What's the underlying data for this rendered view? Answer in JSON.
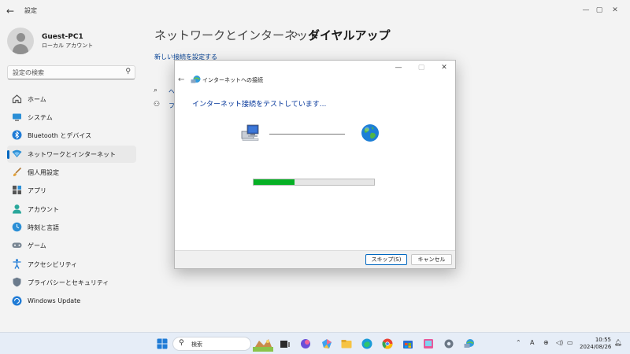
{
  "app": {
    "title": "設定"
  },
  "user": {
    "name": "Guest-PC1",
    "account_type": "ローカル アカウント"
  },
  "search": {
    "placeholder": "設定の検索"
  },
  "nav": [
    {
      "label": "ホーム",
      "icon": "home-icon"
    },
    {
      "label": "システム",
      "icon": "system-icon"
    },
    {
      "label": "Bluetooth とデバイス",
      "icon": "bluetooth-icon"
    },
    {
      "label": "ネットワークとインターネット",
      "icon": "network-icon",
      "selected": true
    },
    {
      "label": "個人用設定",
      "icon": "brush-icon"
    },
    {
      "label": "アプリ",
      "icon": "apps-icon"
    },
    {
      "label": "アカウント",
      "icon": "account-icon"
    },
    {
      "label": "時刻と言語",
      "icon": "time-language-icon"
    },
    {
      "label": "ゲーム",
      "icon": "gaming-icon"
    },
    {
      "label": "アクセシビリティ",
      "icon": "accessibility-icon"
    },
    {
      "label": "プライバシーとセキュリティ",
      "icon": "shield-icon"
    },
    {
      "label": "Windows Update",
      "icon": "windows-update-icon"
    }
  ],
  "breadcrumb": {
    "parent": "ネットワークとインターネット",
    "separator": "›",
    "current": "ダイヤルアップ"
  },
  "main": {
    "new_connection_link": "新しい接続を設定する",
    "row1_fragment": "ヘ",
    "row2_fragment": "フ"
  },
  "dialog": {
    "title": "インターネットへの接続",
    "heading": "インターネット接続をテストしています...",
    "progress": 0.34,
    "skip_label": "スキップ(S)",
    "cancel_label": "キャンセル"
  },
  "taskbar": {
    "search_label": "検索",
    "time": "10:55",
    "date": "2024/08/26",
    "ime_indicator": "A"
  },
  "colors": {
    "accent": "#0067c0",
    "progress_fill": "#06b025",
    "link": "#003e92",
    "dialog_heading": "#003399"
  }
}
